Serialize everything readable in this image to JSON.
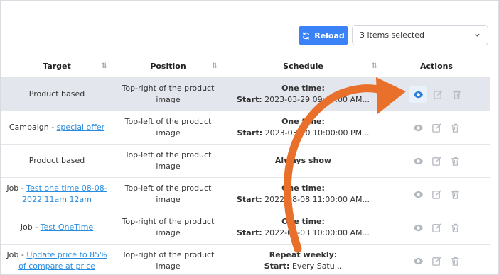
{
  "toolbar": {
    "reload_label": "Reload",
    "selection_label": "3 items selected"
  },
  "table": {
    "headers": [
      "Target",
      "Position",
      "Schedule",
      "Actions"
    ],
    "rows": [
      {
        "target_text": "Product based",
        "target_link": "",
        "position": "Top-right of the product image",
        "schedule_title": "One time:",
        "schedule_prefix": "Start:",
        "schedule_value": " 2023-03-29 09:47:00 AM..."
      },
      {
        "target_text": "Campaign - ",
        "target_link": "special offer",
        "position": "Top-left of the product image",
        "schedule_title": "One time:",
        "schedule_prefix": "Start:",
        "schedule_value": " 2023-03-10 10:00:00 PM..."
      },
      {
        "target_text": "Product based",
        "target_link": "",
        "position": "Top-left of the product image",
        "schedule_title": "Always show",
        "schedule_prefix": "",
        "schedule_value": ""
      },
      {
        "target_text": "Job - ",
        "target_link": "Test one time 08-08-2022 11am 12am",
        "position": "Top-left of the product image",
        "schedule_title": "One time:",
        "schedule_prefix": "Start:",
        "schedule_value": " 2022-08-08 11:00:00 AM..."
      },
      {
        "target_text": "Job - ",
        "target_link": "Test OneTime",
        "position": "Top-right of the product image",
        "schedule_title": "One time:",
        "schedule_prefix": "Start:",
        "schedule_value": " 2022-08-03 10:00:00 AM..."
      },
      {
        "target_text": "Job - ",
        "target_link": "Update price to 85% of compare at price",
        "position": "Top-right of the product image",
        "schedule_title": "Repeat weekly:",
        "schedule_prefix": "Start:",
        "schedule_value": " Every Satu..."
      }
    ]
  },
  "icons": {
    "reload": "refresh-icon",
    "dropdown": "chevron-down-icon",
    "sort": "sort-icon",
    "view": "eye-icon",
    "edit": "edit-icon",
    "delete": "trash-icon"
  },
  "colors": {
    "primary": "#3b82f6",
    "link": "#2a8ee0",
    "annotation_arrow": "#e8702a",
    "selected_row": "#e4e6ee",
    "icon": "#b3b8bf"
  }
}
